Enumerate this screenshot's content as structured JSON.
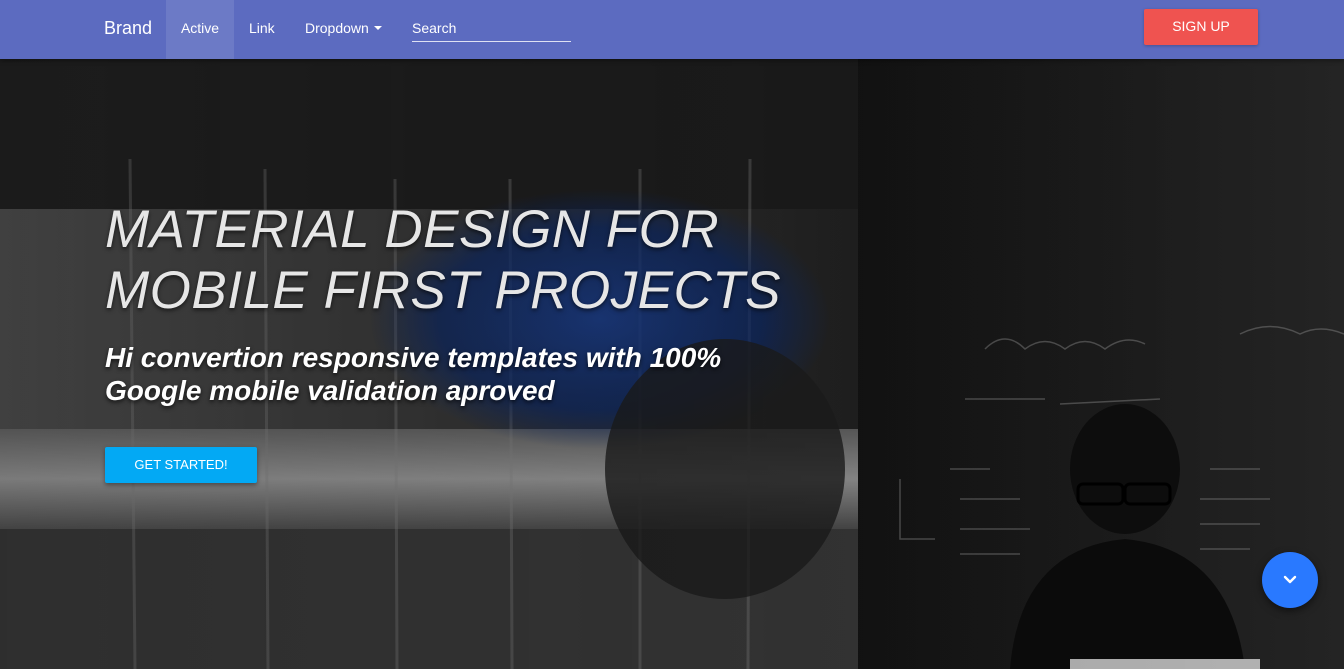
{
  "navbar": {
    "brand": "Brand",
    "items": [
      {
        "label": "Active",
        "active": true
      },
      {
        "label": "Link"
      },
      {
        "label": "Dropdown",
        "icon": "caret-down-icon"
      }
    ],
    "search": {
      "placeholder": "Search",
      "value": ""
    },
    "signup_label": "SIGN UP"
  },
  "hero": {
    "title_line1": "MATERIAL DESIGN FOR",
    "title_line2": "MOBILE FIRST PROJECTS",
    "subtitle_line1": "Hi convertion responsive templates with 100%",
    "subtitle_line2": "Google mobile validation aproved",
    "cta_label": "GET STARTED!",
    "scroll_icon": "chevron-down-icon"
  },
  "colors": {
    "navbar": "#5c6bc0",
    "signup": "#ef5350",
    "cta": "#03a9f4",
    "fab": "#2979ff"
  }
}
